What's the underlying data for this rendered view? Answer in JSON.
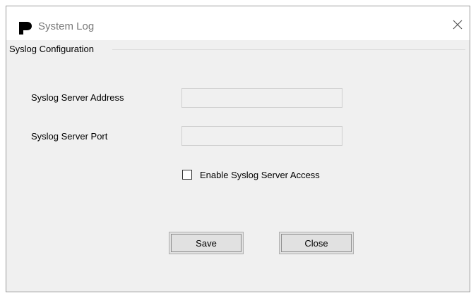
{
  "window": {
    "title": "System Log",
    "close_glyph": "✕"
  },
  "group": {
    "title": "Syslog Configuration"
  },
  "fields": {
    "server_address": {
      "label": "Syslog Server Address",
      "value": ""
    },
    "server_port": {
      "label": "Syslog Server Port",
      "value": ""
    }
  },
  "options": {
    "enable_access": {
      "label": "Enable Syslog Server Access",
      "checked": false
    }
  },
  "buttons": {
    "save": "Save",
    "close": "Close"
  },
  "icons": {
    "app": "app-logo-icon",
    "close": "close-icon"
  },
  "colors": {
    "window_bg": "#f0f0f0",
    "titlebar_bg": "#ffffff",
    "title_text": "#7a7a7a"
  }
}
